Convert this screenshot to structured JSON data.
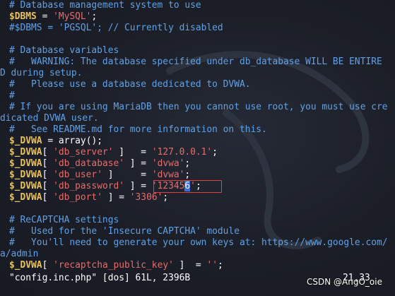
{
  "editor": {
    "lines": [
      {
        "segments": [
          {
            "t": "# Database management system to use",
            "c": "cmt"
          }
        ]
      },
      {
        "segments": [
          {
            "t": "$DBMS",
            "c": "var"
          },
          {
            "t": " = ",
            "c": "op"
          },
          {
            "t": "'MySQL'",
            "c": "str"
          },
          {
            "t": ";",
            "c": "op"
          }
        ]
      },
      {
        "segments": [
          {
            "t": "#$DBMS = 'PGSQL'; // Currently disabled",
            "c": "cmt"
          }
        ]
      },
      {
        "segments": []
      },
      {
        "segments": [
          {
            "t": "# Database variables",
            "c": "cmt"
          }
        ]
      },
      {
        "segments": [
          {
            "t": "#   WARNING: The database specified under db_database WILL BE ENTIRE",
            "c": "cmt"
          }
        ]
      },
      {
        "wrap": true,
        "segments": [
          {
            "t": "D during setup.",
            "c": "cmt"
          }
        ]
      },
      {
        "segments": [
          {
            "t": "#   Please use a database dedicated to DVWA.",
            "c": "cmt"
          }
        ]
      },
      {
        "segments": [
          {
            "t": "#",
            "c": "cmt"
          }
        ]
      },
      {
        "segments": [
          {
            "t": "# If you are using MariaDB then you cannot use root, you must use cre",
            "c": "cmt"
          }
        ]
      },
      {
        "wrap": true,
        "segments": [
          {
            "t": "dicated DVWA user.",
            "c": "cmt"
          }
        ]
      },
      {
        "segments": [
          {
            "t": "#   See README.md for more information on this.",
            "c": "cmt"
          }
        ]
      },
      {
        "segments": [
          {
            "t": "$_DVWA",
            "c": "var"
          },
          {
            "t": " = ",
            "c": "op"
          },
          {
            "t": "array",
            "c": "fn"
          },
          {
            "t": "();",
            "c": "op"
          }
        ]
      },
      {
        "segments": [
          {
            "t": "$_DVWA",
            "c": "var"
          },
          {
            "t": "[ ",
            "c": "op"
          },
          {
            "t": "'db_server'",
            "c": "key"
          },
          {
            "t": " ]   = ",
            "c": "op"
          },
          {
            "t": "'127.0.0.1'",
            "c": "str"
          },
          {
            "t": ";",
            "c": "op"
          }
        ]
      },
      {
        "segments": [
          {
            "t": "$_DVWA",
            "c": "var"
          },
          {
            "t": "[ ",
            "c": "op"
          },
          {
            "t": "'db_database'",
            "c": "key"
          },
          {
            "t": " ] = ",
            "c": "op"
          },
          {
            "t": "'dvwa'",
            "c": "str"
          },
          {
            "t": ";",
            "c": "op"
          }
        ]
      },
      {
        "segments": [
          {
            "t": "$_DVWA",
            "c": "var"
          },
          {
            "t": "[ ",
            "c": "op"
          },
          {
            "t": "'db_user'",
            "c": "key"
          },
          {
            "t": " ]     = ",
            "c": "op"
          },
          {
            "t": "'dvwa'",
            "c": "str"
          },
          {
            "t": ";",
            "c": "op"
          }
        ]
      },
      {
        "segments": [
          {
            "t": "$_DVWA",
            "c": "var"
          },
          {
            "t": "[ ",
            "c": "op"
          },
          {
            "t": "'db_password'",
            "c": "key"
          },
          {
            "t": " ] = ",
            "c": "op"
          },
          {
            "t": "'12345",
            "c": "str"
          },
          {
            "t": "6",
            "c": "cursor"
          },
          {
            "t": "'",
            "c": "str"
          },
          {
            "t": ";",
            "c": "op"
          }
        ]
      },
      {
        "segments": [
          {
            "t": "$_DVWA",
            "c": "var"
          },
          {
            "t": "[ ",
            "c": "op"
          },
          {
            "t": "'db_port'",
            "c": "key"
          },
          {
            "t": " ] = ",
            "c": "op"
          },
          {
            "t": "'3306'",
            "c": "str"
          },
          {
            "t": ";",
            "c": "op"
          }
        ]
      },
      {
        "segments": []
      },
      {
        "segments": [
          {
            "t": "# ReCAPTCHA settings",
            "c": "cmt"
          }
        ]
      },
      {
        "segments": [
          {
            "t": "#   Used for the 'Insecure CAPTCHA' module",
            "c": "cmt"
          }
        ]
      },
      {
        "segments": [
          {
            "t": "#   You'll need to generate your own keys at: https://www.google.com/",
            "c": "cmt"
          }
        ]
      },
      {
        "wrap": true,
        "segments": [
          {
            "t": "a/admin",
            "c": "cmt"
          }
        ]
      },
      {
        "segments": [
          {
            "t": "$_DVWA",
            "c": "var"
          },
          {
            "t": "[ ",
            "c": "op"
          },
          {
            "t": "'recaptcha_public_key'",
            "c": "key"
          },
          {
            "t": " ]  = ",
            "c": "op"
          },
          {
            "t": "''",
            "c": "str"
          },
          {
            "t": ";",
            "c": "op"
          }
        ]
      }
    ]
  },
  "status": {
    "file_info": "\"config.inc.php\" [dos] 61L, 2396B",
    "position": "21,33"
  },
  "watermark_text": "CSDN @AngO_oie",
  "icons": {
    "background": "kali-dragon-watermark"
  },
  "colors": {
    "comment": "#5fa1e6",
    "variable": "#e8c25a",
    "string": "#e96a6a",
    "highlight_box": "#e04040",
    "cursor": "#3b6fd8",
    "background": "#1b1e27"
  }
}
